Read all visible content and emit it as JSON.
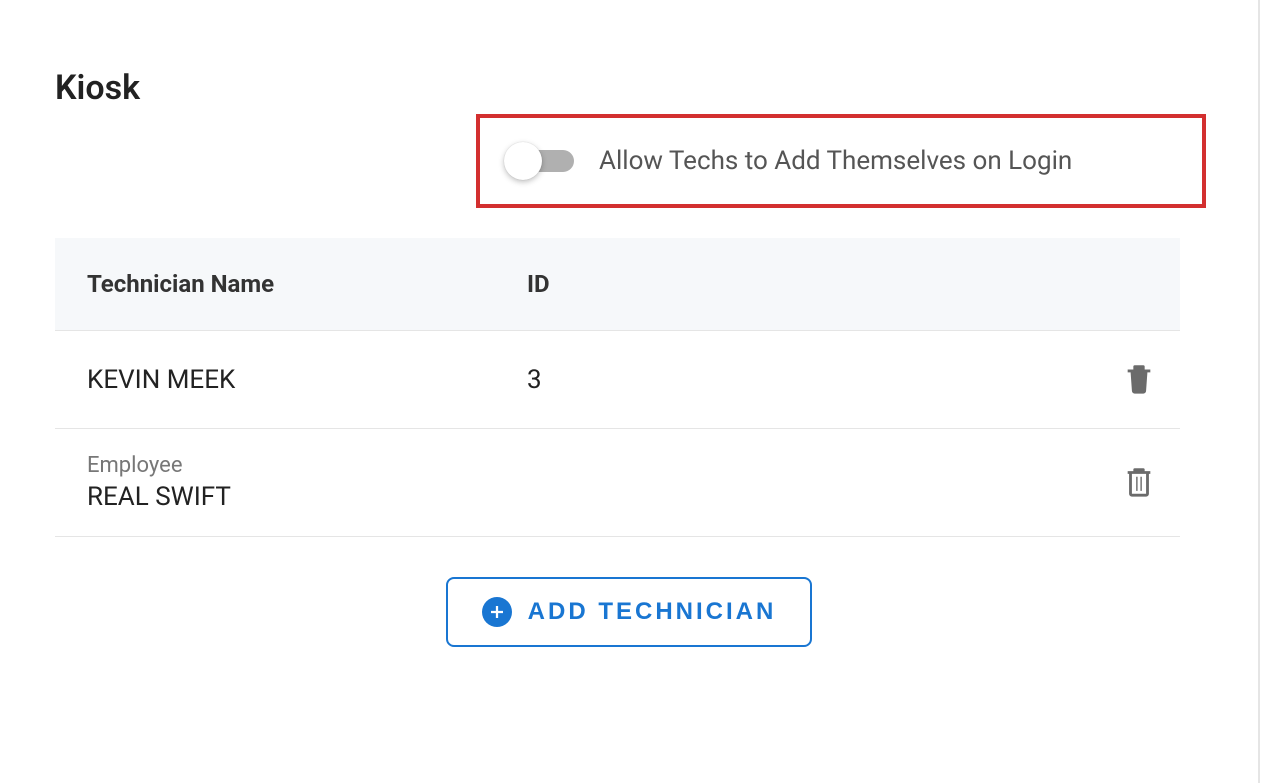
{
  "page": {
    "title": "Kiosk"
  },
  "toggle": {
    "label": "Allow Techs to Add Themselves on Login",
    "enabled": false
  },
  "table": {
    "headers": {
      "name": "Technician Name",
      "id": "ID"
    },
    "rows": [
      {
        "sublabel": "",
        "name": "KEVIN MEEK",
        "id": "3"
      },
      {
        "sublabel": "Employee",
        "name": "REAL SWIFT",
        "id": ""
      }
    ]
  },
  "actions": {
    "add_technician": "ADD TECHNICIAN"
  }
}
